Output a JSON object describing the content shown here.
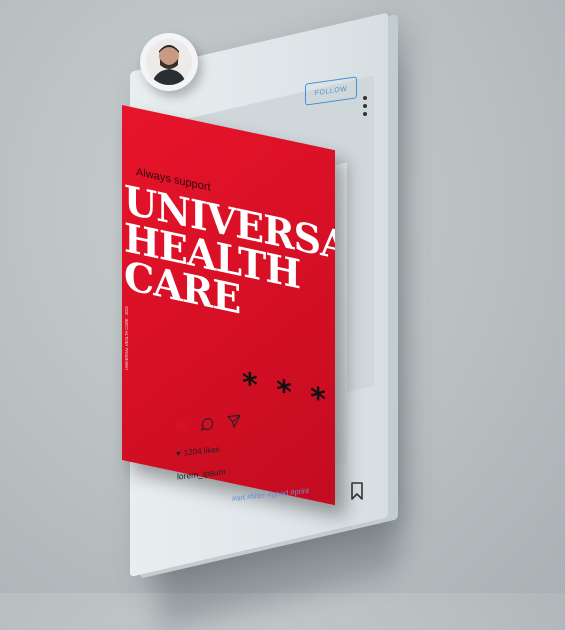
{
  "profile": {
    "follow_label": "FOLLOW"
  },
  "poster": {
    "tagline": "Always support",
    "title_line1": "UNIVERSAL",
    "title_line2": "HEALTH CARE",
    "side_text": "UNIVERSAL HEALTH CARE · 2021",
    "asterisks": "* * *",
    "color": "#e8142b"
  },
  "post": {
    "likes_text": "1204 likes",
    "username": "lorem_ipsum",
    "hashtags": "#art #filter #good #print"
  },
  "icons": {
    "like": "heart-icon",
    "comment": "comment-icon",
    "share": "send-icon",
    "save": "bookmark-icon",
    "menu": "more-vertical-icon"
  }
}
